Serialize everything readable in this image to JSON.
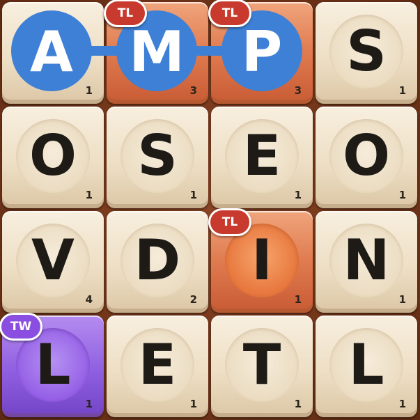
{
  "board": {
    "tiles": [
      {
        "letter": "A",
        "points": "1",
        "bonus": ""
      },
      {
        "letter": "M",
        "points": "3",
        "bonus": "TL"
      },
      {
        "letter": "P",
        "points": "3",
        "bonus": "TL"
      },
      {
        "letter": "S",
        "points": "1",
        "bonus": ""
      },
      {
        "letter": "O",
        "points": "1",
        "bonus": ""
      },
      {
        "letter": "S",
        "points": "1",
        "bonus": ""
      },
      {
        "letter": "E",
        "points": "1",
        "bonus": ""
      },
      {
        "letter": "O",
        "points": "1",
        "bonus": ""
      },
      {
        "letter": "V",
        "points": "4",
        "bonus": ""
      },
      {
        "letter": "D",
        "points": "2",
        "bonus": ""
      },
      {
        "letter": "I",
        "points": "1",
        "bonus": "TL"
      },
      {
        "letter": "N",
        "points": "1",
        "bonus": ""
      },
      {
        "letter": "L",
        "points": "1",
        "bonus": "TW"
      },
      {
        "letter": "E",
        "points": "1",
        "bonus": ""
      },
      {
        "letter": "T",
        "points": "1",
        "bonus": ""
      },
      {
        "letter": "L",
        "points": "1",
        "bonus": ""
      }
    ]
  },
  "selection": {
    "word": "AMP",
    "letters": [
      "A",
      "M",
      "P"
    ],
    "highlight_color": "#3d80d6"
  },
  "colors": {
    "tile_normal": "#f2e6d0",
    "tile_triple_letter": "#e07a4f",
    "tile_triple_word": "#8e5fe0",
    "badge_triple_letter": "#c93a2e",
    "badge_triple_word": "#8a4fe0",
    "board_background": "#6b3218"
  }
}
